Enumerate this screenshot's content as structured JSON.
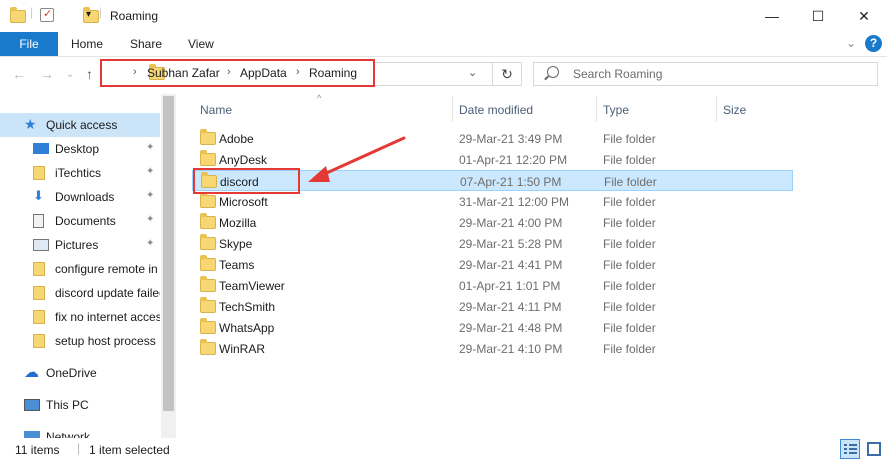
{
  "window": {
    "title": "Roaming",
    "minimize": "—",
    "maximize": "☐",
    "close": "✕"
  },
  "ribbon": {
    "tabs": [
      "File",
      "Home",
      "Share",
      "View"
    ],
    "help": "?"
  },
  "address": {
    "crumbs": [
      "Subhan Zafar",
      "AppData",
      "Roaming"
    ],
    "search_placeholder": "Search Roaming"
  },
  "nav_pane": {
    "items": [
      {
        "label": "Quick access",
        "icon": "star-icon"
      },
      {
        "label": "Desktop",
        "icon": "desktop-icon",
        "pinned": true
      },
      {
        "label": "iTechtics",
        "icon": "folder-icon",
        "pinned": true
      },
      {
        "label": "Downloads",
        "icon": "download-icon",
        "pinned": true
      },
      {
        "label": "Documents",
        "icon": "documents-icon",
        "pinned": true
      },
      {
        "label": "Pictures",
        "icon": "pictures-icon",
        "pinned": true
      },
      {
        "label": "configure remote in",
        "icon": "folder-icon"
      },
      {
        "label": "discord update failed",
        "icon": "folder-icon"
      },
      {
        "label": "fix no internet access",
        "icon": "folder-icon"
      },
      {
        "label": "setup host process",
        "icon": "folder-icon"
      },
      {
        "label": "OneDrive",
        "icon": "onedrive-icon"
      },
      {
        "label": "This PC",
        "icon": "pc-icon"
      },
      {
        "label": "Network",
        "icon": "network-icon"
      }
    ]
  },
  "columns": [
    "Name",
    "Date modified",
    "Type",
    "Size"
  ],
  "files": [
    {
      "name": "Adobe",
      "date": "29-Mar-21 3:49 PM",
      "type": "File folder"
    },
    {
      "name": "AnyDesk",
      "date": "01-Apr-21 12:20 PM",
      "type": "File folder"
    },
    {
      "name": "discord",
      "date": "07-Apr-21 1:50 PM",
      "type": "File folder",
      "selected": true
    },
    {
      "name": "Microsoft",
      "date": "31-Mar-21 12:00 PM",
      "type": "File folder"
    },
    {
      "name": "Mozilla",
      "date": "29-Mar-21 4:00 PM",
      "type": "File folder"
    },
    {
      "name": "Skype",
      "date": "29-Mar-21 5:28 PM",
      "type": "File folder"
    },
    {
      "name": "Teams",
      "date": "29-Mar-21 4:41 PM",
      "type": "File folder"
    },
    {
      "name": "TeamViewer",
      "date": "01-Apr-21 1:01 PM",
      "type": "File folder"
    },
    {
      "name": "TechSmith",
      "date": "29-Mar-21 4:11 PM",
      "type": "File folder"
    },
    {
      "name": "WhatsApp",
      "date": "29-Mar-21 4:48 PM",
      "type": "File folder"
    },
    {
      "name": "WinRAR",
      "date": "29-Mar-21 4:10 PM",
      "type": "File folder"
    }
  ],
  "status": {
    "item_count": "11 items",
    "selected_count": "1 item selected"
  },
  "colors": {
    "accent": "#1979ca",
    "selection": "#cce8ff",
    "annotation": "#e53935"
  }
}
